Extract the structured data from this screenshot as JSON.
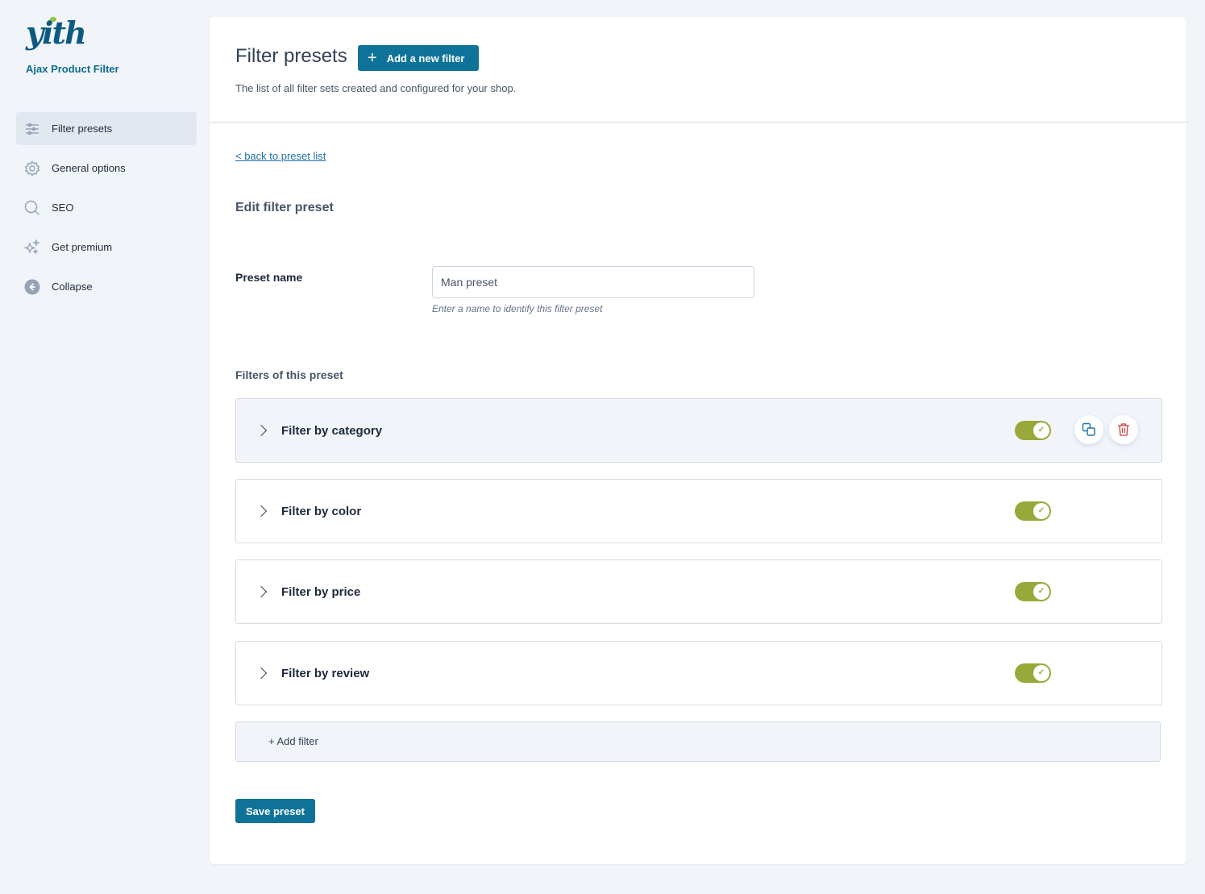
{
  "sidebar": {
    "logo": "yith",
    "plugin_name": "Ajax Product Filter",
    "items": [
      {
        "label": "Filter presets",
        "icon": "sliders-icon",
        "active": true
      },
      {
        "label": "General options",
        "icon": "gear-icon"
      },
      {
        "label": "SEO",
        "icon": "search-icon"
      },
      {
        "label": "Get premium",
        "icon": "sparkles-icon"
      },
      {
        "label": "Collapse",
        "icon": "arrow-left-circle-icon"
      }
    ]
  },
  "header": {
    "title": "Filter presets",
    "add_button": "Add a new filter",
    "subtitle": "The list of all filter sets created and configured for your shop."
  },
  "content": {
    "back_link": "< back to preset list",
    "edit_title": "Edit filter preset",
    "preset_name_label": "Preset name",
    "preset_name_value": "Man preset",
    "preset_name_help": "Enter a name to identify this filter preset",
    "filters_label": "Filters of this preset",
    "filters": [
      {
        "name": "Filter by category",
        "enabled": true
      },
      {
        "name": "Filter by color",
        "enabled": true
      },
      {
        "name": "Filter by price",
        "enabled": true
      },
      {
        "name": "Filter by review",
        "enabled": true
      }
    ],
    "add_filter": "+ Add filter",
    "save_button": "Save preset"
  },
  "colors": {
    "primary": "#0f7399",
    "toggle_on": "#99a83a",
    "delete": "#c9403f"
  }
}
